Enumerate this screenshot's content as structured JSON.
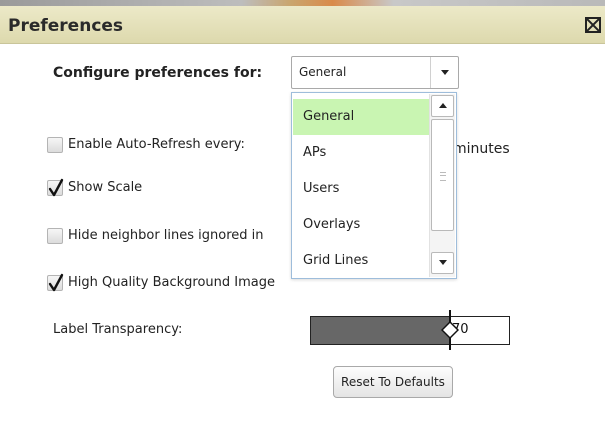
{
  "window": {
    "title": "Preferences"
  },
  "config": {
    "label": "Configure preferences for:",
    "selected": "General",
    "options": [
      "General",
      "APs",
      "Users",
      "Overlays",
      "Grid Lines"
    ]
  },
  "options": [
    {
      "label": "Enable Auto-Refresh every:",
      "checked": false
    },
    {
      "label": "Show Scale",
      "checked": true
    },
    {
      "label": "Hide neighbor lines ignored in",
      "checked": false
    },
    {
      "label": "High Quality Background Image",
      "checked": true
    }
  ],
  "refresh_unit": "minutes",
  "transparency": {
    "label": "Label Transparency:",
    "value": "70",
    "level_percent": 70
  },
  "reset_label": "Reset To Defaults",
  "colors": {
    "titlebar": "#e3dfb8",
    "selected_item": "#c9f5b2",
    "slider_fill": "#676767"
  }
}
